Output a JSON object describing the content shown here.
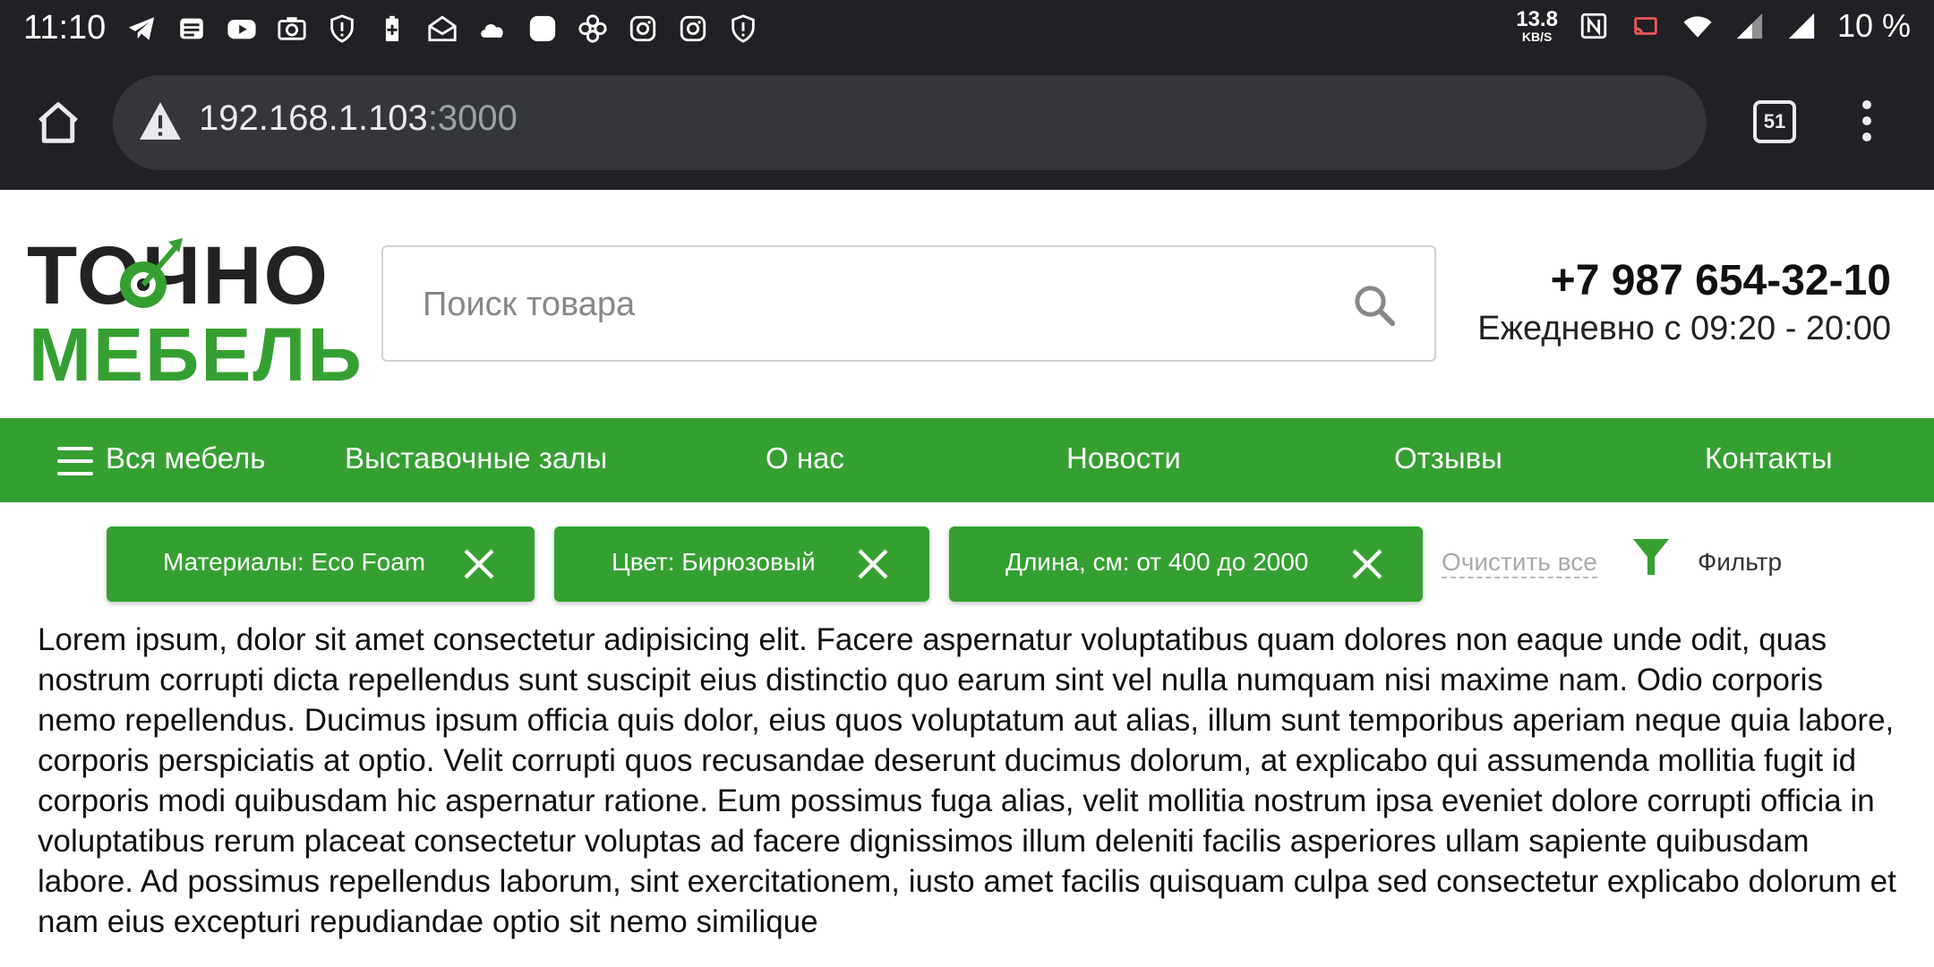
{
  "status_bar": {
    "time": "11:10",
    "net_speed": "13.8",
    "net_unit": "KB/S",
    "battery": "10 %",
    "icons": [
      "telegram-icon",
      "news-icon",
      "youtube-icon",
      "camera-icon",
      "shield-icon",
      "battery-saver-icon",
      "mail-icon",
      "cloud-icon",
      "app-icon",
      "pinwheel-icon",
      "instagram-icon",
      "instagram-icon",
      "shield-icon",
      "nfc-icon",
      "cast-icon",
      "wifi-icon",
      "signal-icon",
      "signal-icon"
    ]
  },
  "browser": {
    "url_host": "192.168.1.103",
    "url_port": ":3000",
    "tab_count": "51"
  },
  "header": {
    "logo_line1": "ТОЧНО",
    "logo_line2": "МЕБЕЛЬ",
    "search_placeholder": "Поиск товара",
    "phone": "+7 987 654-32-10",
    "hours": "Ежедневно с 09:20 - 20:00"
  },
  "nav": {
    "items": [
      "Вся мебель",
      "Выставочные залы",
      "О нас",
      "Новости",
      "Отзывы",
      "Контакты"
    ]
  },
  "filters": {
    "chips": [
      "Материалы: Eco Foam",
      "Цвет: Бирюзовый",
      "Длина, см: от 400 до 2000"
    ],
    "clear_all": "Очистить все",
    "filter_label": "Фильтр"
  },
  "content": {
    "text": "Lorem ipsum, dolor sit amet consectetur adipisicing elit. Facere aspernatur voluptatibus quam dolores non eaque unde odit, quas nostrum corrupti dicta repellendus sunt suscipit eius distinctio quo earum sint vel nulla numquam nisi maxime nam. Odio corporis nemo repellendus. Ducimus ipsum officia quis dolor, eius quos voluptatum aut alias, illum sunt temporibus aperiam neque quia labore, corporis perspiciatis at optio. Velit corrupti quos recusandae deserunt ducimus dolorum, at explicabo qui assumenda mollitia fugit id corporis modi quibusdam hic aspernatur ratione. Eum possimus fuga alias, velit mollitia nostrum ipsa eveniet dolore corrupti officia in voluptatibus rerum placeat consectetur voluptas ad facere dignissimos illum deleniti facilis asperiores ullam sapiente quibusdam labore. Ad possimus repellendus laborum, sint exercitationem, iusto amet facilis quisquam culpa sed consectetur explicabo dolorum et nam eius excepturi repudiandae optio sit nemo similique"
  },
  "colors": {
    "brand_green": "#35a031",
    "browser_dark": "#202124"
  }
}
